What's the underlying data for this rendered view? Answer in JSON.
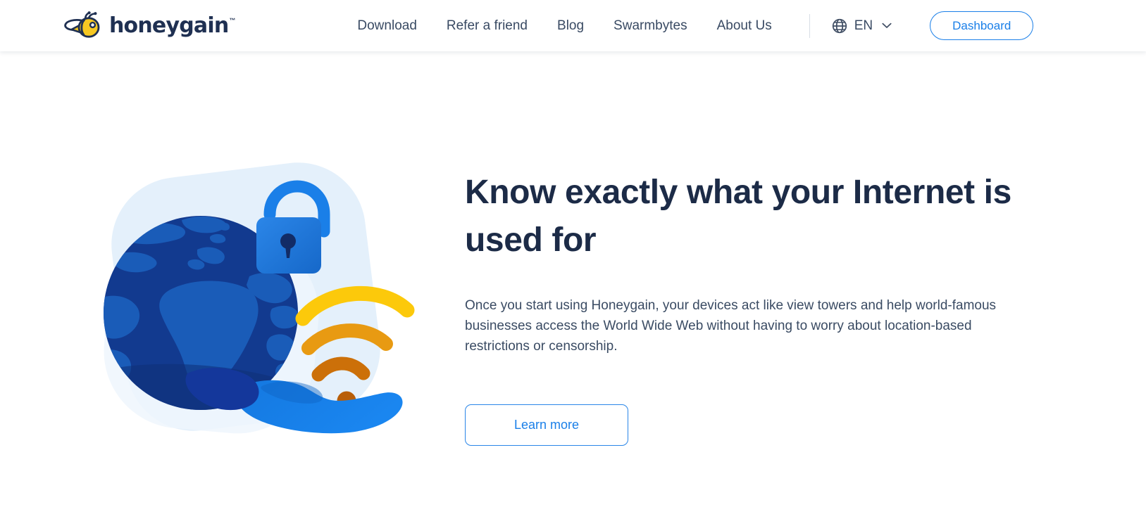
{
  "brand": {
    "name": "honeygain",
    "trademark": "™",
    "logo_icon": "bee-icon",
    "wordmark_color": "#1f3052",
    "bee_body_color": "#F6C822",
    "bee_outline_color": "#1f3052"
  },
  "header": {
    "nav": [
      {
        "label": "Download",
        "name": "nav-link-download"
      },
      {
        "label": "Refer a friend",
        "name": "nav-link-refer-a-friend"
      },
      {
        "label": "Blog",
        "name": "nav-link-blog"
      },
      {
        "label": "Swarmbytes",
        "name": "nav-link-swarmbytes"
      },
      {
        "label": "About Us",
        "name": "nav-link-about-us"
      }
    ],
    "language": {
      "icon": "globe-icon",
      "code": "EN",
      "chevron": "chevron-down-icon",
      "options": [
        "EN"
      ]
    },
    "dashboard_button": {
      "label": "Dashboard",
      "border_color": "#1a7fe8",
      "text_color": "#1a7fe8"
    },
    "nav_text_color": "#394a63",
    "background": "#ffffff"
  },
  "hero": {
    "title": "Know exactly what your Internet is used for",
    "paragraph": "Once you start using Honeygain, your devices act like view towers and help world-famous businesses access the World Wide Web without having to worry about location-based restrictions or censorship.",
    "cta": {
      "label": "Learn more",
      "border_color": "#2a86e8",
      "text_color": "#1a7fe8"
    },
    "title_color": "#1c2b47",
    "paragraph_color": "#3a4b63",
    "illustration": {
      "name": "globe-padlock-wifi-hand-illustration",
      "parts": [
        "background-blob",
        "globe-icon",
        "padlock-icon",
        "wifi-signal-icon",
        "open-hand-icon"
      ],
      "colors": {
        "blob": "#E4F0FB",
        "blob_soft": "#EFF6FD",
        "globe_ocean": "#123A8F",
        "globe_land": "#1A5CB8",
        "globe_shadow": "#0F2F77",
        "padlock_shackle": "#1A7FE8",
        "padlock_body_light": "#2B86E8",
        "padlock_body_dark": "#1668C9",
        "padlock_keyhole": "#122C66",
        "wifi_arc_outer": "#FCC90B",
        "wifi_arc_middle": "#E89A12",
        "wifi_arc_inner": "#CC7009",
        "wifi_dot": "#B85E08",
        "hand_light": "#1478E0",
        "hand_dark": "#14379B"
      }
    }
  },
  "page": {
    "background": "#ffffff"
  }
}
